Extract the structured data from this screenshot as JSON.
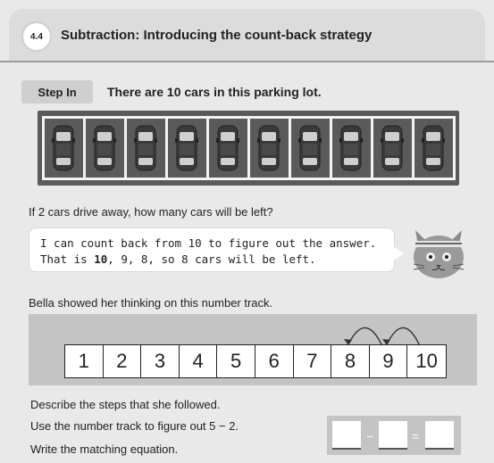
{
  "lesson": {
    "number": "4.4",
    "title": "Subtraction: Introducing the count-back strategy"
  },
  "step": {
    "label": "Step In",
    "text": "There are 10 cars in this parking lot."
  },
  "parking": {
    "car_count": 10,
    "icon": "car-icon"
  },
  "question": "If 2 cars drive away, how many cars will be left?",
  "bubble": {
    "line1": "I can count back from 10 to figure out the answer.",
    "line2_pre": "That is ",
    "line2_bold": "10",
    "line2_post": ", 9, 8, so 8 cars will be left."
  },
  "track_intro": "Bella showed her thinking on this number track.",
  "track": [
    "1",
    "2",
    "3",
    "4",
    "5",
    "6",
    "7",
    "8",
    "9",
    "10"
  ],
  "instructions": {
    "describe": "Describe the steps that she followed.",
    "use": "Use the number track to figure out 5 − 2.",
    "write": "Write the matching equation."
  },
  "equation": {
    "minus": "−",
    "equals": "="
  },
  "colors": {
    "header_bg": "#dcdcdc",
    "page_bg": "#e9e9e9",
    "lot_bg": "#5a5a5a",
    "track_bg": "#c4c4c4"
  }
}
